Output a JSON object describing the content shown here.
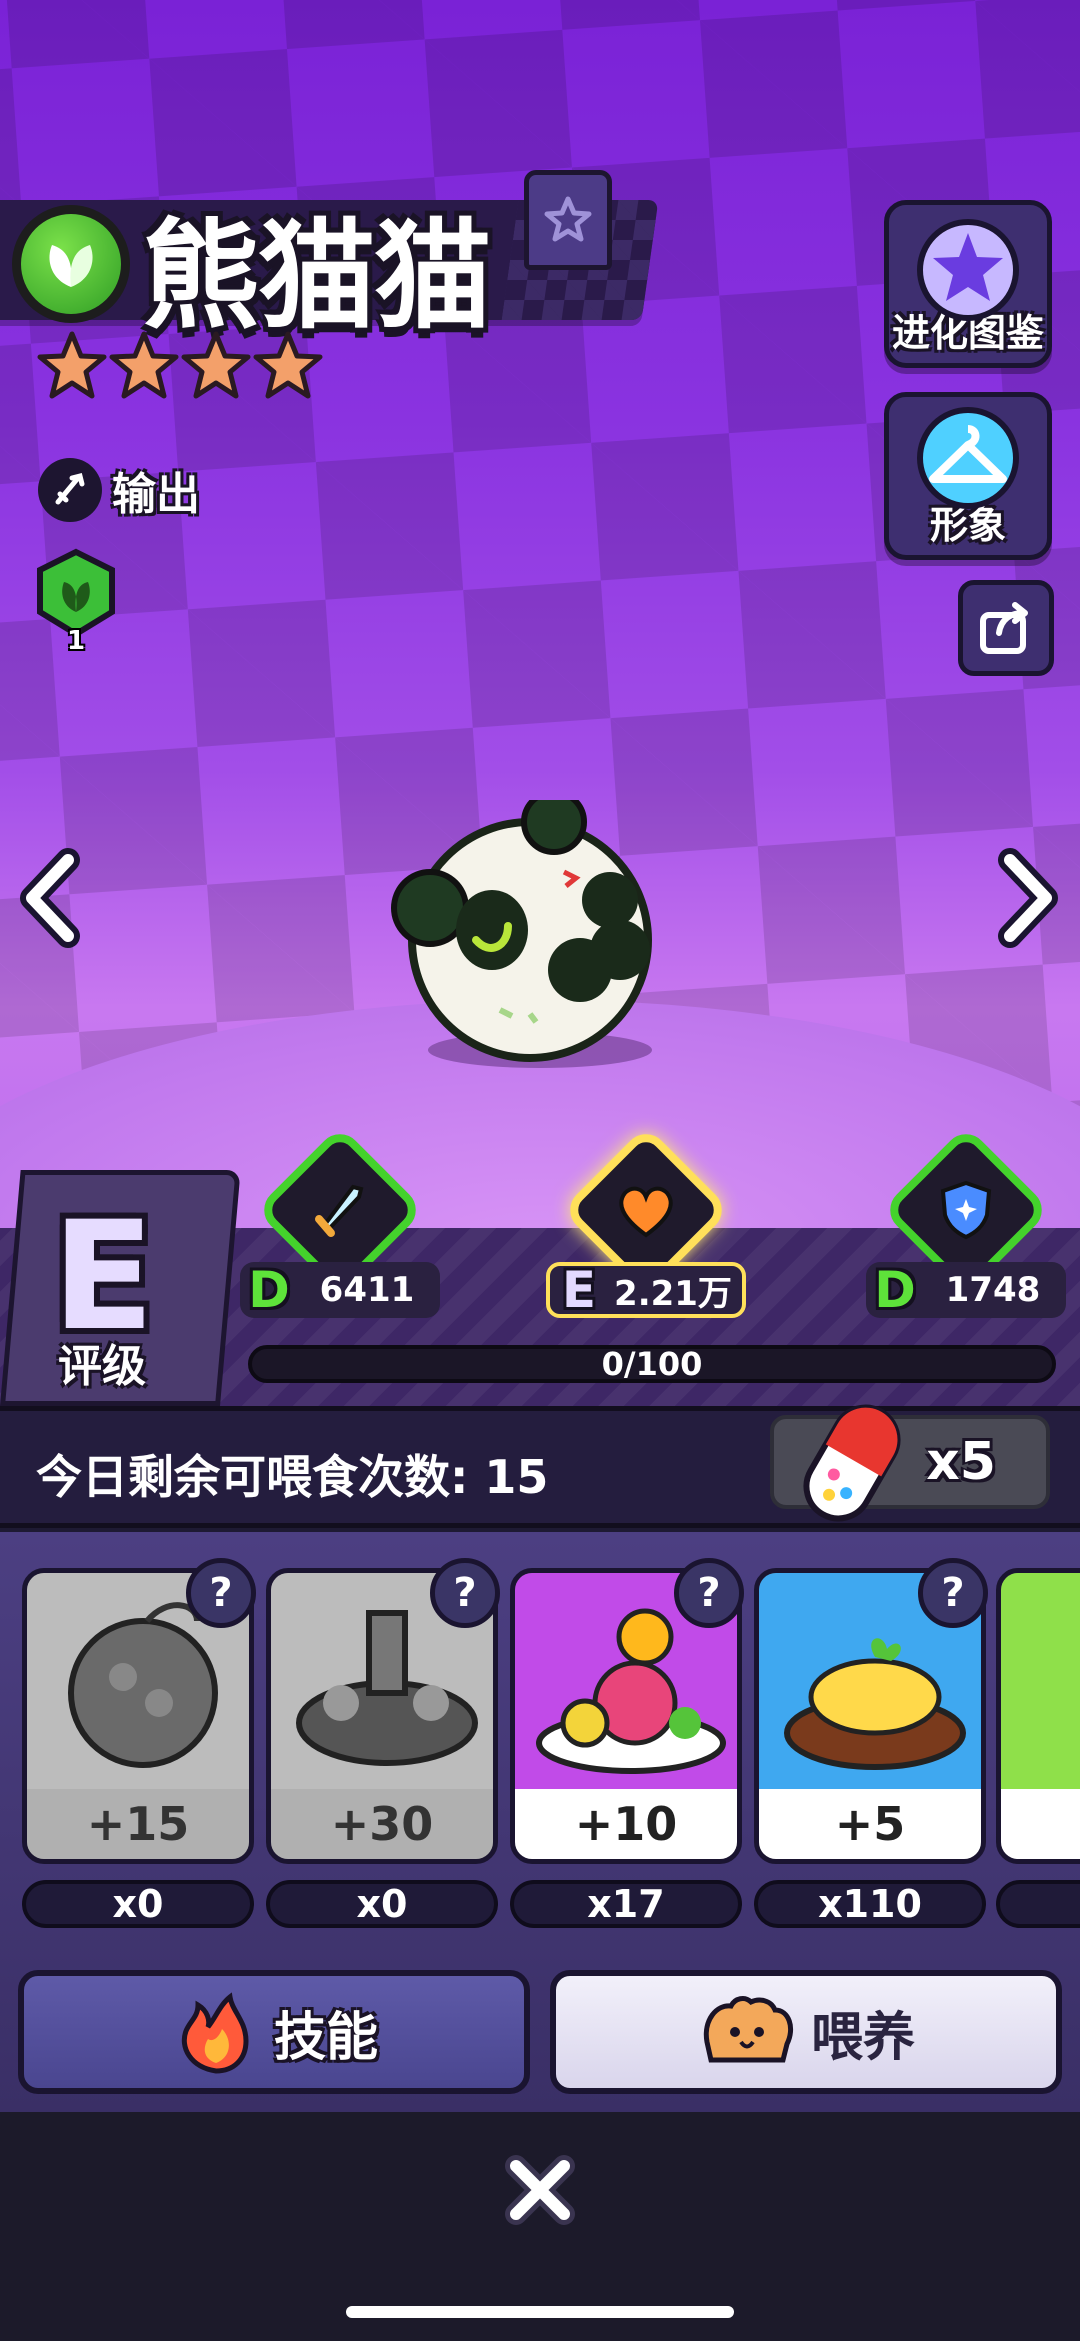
{
  "character": {
    "name": "熊猫猫",
    "stars": 4,
    "role_label": "输出",
    "element_level": "1"
  },
  "side_buttons": {
    "evolution_label": "进化图鉴",
    "appearance_label": "形象"
  },
  "rating": {
    "letter": "E",
    "label": "评级"
  },
  "stats": {
    "attack": {
      "grade": "D",
      "value": "6411"
    },
    "hp": {
      "grade": "E",
      "value": "2.21万"
    },
    "defense": {
      "grade": "D",
      "value": "1748"
    },
    "progress_text": "0/100",
    "progress_fraction": 0
  },
  "feeding": {
    "remaining_text": "今日剩余可喂食次数: 15",
    "capsule_count": "x5"
  },
  "foods": [
    {
      "bonus": "+15",
      "count": "x0",
      "unknown": "?"
    },
    {
      "bonus": "+30",
      "count": "x0",
      "unknown": "?"
    },
    {
      "bonus": "+10",
      "count": "x17",
      "unknown": "?"
    },
    {
      "bonus": "+5",
      "count": "x110",
      "unknown": "?"
    }
  ],
  "actions": {
    "skill_label": "技能",
    "feed_label": "喂养"
  },
  "colors": {
    "grade_green": "#5ee23a",
    "highlight_gold": "#ffe05a",
    "panel_dark": "#241d3e"
  }
}
